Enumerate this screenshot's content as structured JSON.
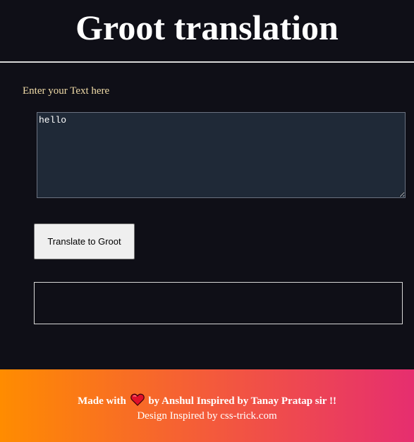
{
  "header": {
    "title": "Groot translation"
  },
  "input": {
    "label": "Enter your Text here",
    "value": "hello"
  },
  "translate_button": {
    "label": "Translate to Groot"
  },
  "output": {
    "text": ""
  },
  "footer": {
    "made_with": "Made with",
    "heart_icon": "heart-icon",
    "credit": "by Anshul Inspired by Tanay Pratap sir !!",
    "design_credit": "Design Inspired by css-trick.com"
  },
  "colors": {
    "background": "#0f0f17",
    "label": "#f1dca8",
    "textarea_bg": "#1f2937",
    "footer_gradient_start": "#ff8c00",
    "footer_gradient_end": "#e62e6f"
  }
}
